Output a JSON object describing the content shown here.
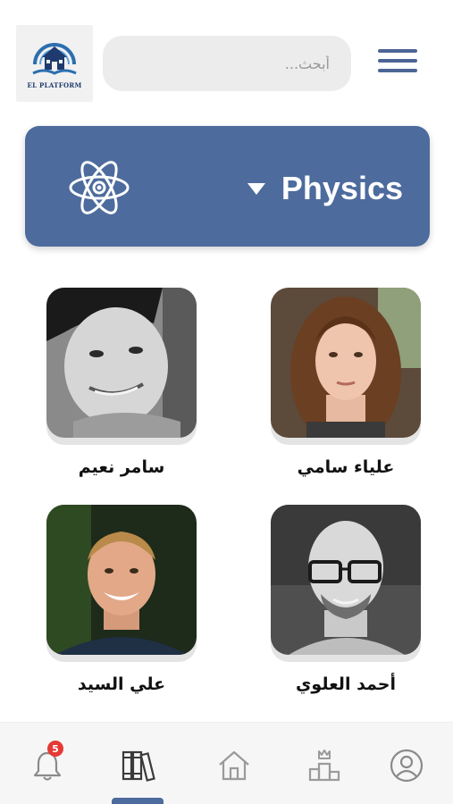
{
  "header": {
    "logo_text": "EL PLATFORM",
    "search_placeholder": "أبحث...",
    "menu_icon": "hamburger-menu-icon"
  },
  "subject": {
    "label": "Physics",
    "icon": "atom-icon",
    "dropdown_icon": "caret-down-icon"
  },
  "teachers": [
    {
      "name": "علياء سامي",
      "photo": "teacher-photo-aliaa"
    },
    {
      "name": "سامر نعيم",
      "photo": "teacher-photo-samer"
    },
    {
      "name": "أحمد العلوي",
      "photo": "teacher-photo-ahmed"
    },
    {
      "name": "علي السيد",
      "photo": "teacher-photo-ali"
    }
  ],
  "bottom_nav": {
    "items": [
      {
        "icon": "bell-icon",
        "badge": "5"
      },
      {
        "icon": "books-icon",
        "active": true
      },
      {
        "icon": "home-icon"
      },
      {
        "icon": "podium-crown-icon"
      },
      {
        "icon": "user-profile-icon"
      }
    ]
  },
  "colors": {
    "accent": "#4d6b9d",
    "badge": "#e53935",
    "search_bg": "#ececec"
  }
}
